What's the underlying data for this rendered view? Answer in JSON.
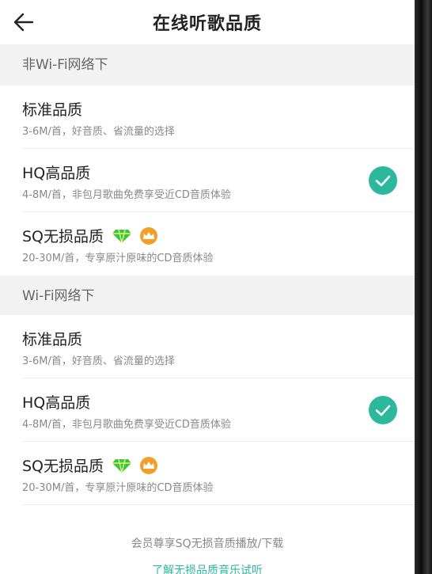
{
  "header": {
    "title": "在线听歌品质"
  },
  "colors": {
    "accent": "#2bb89c",
    "vip_orange": "#f0a02a",
    "gem_green": "#3fc24a"
  },
  "sections": [
    {
      "title": "非Wi-Fi网络下",
      "options": [
        {
          "title": "标准品质",
          "desc": "3-6M/首，好音质、省流量的选择",
          "selected": false
        },
        {
          "title": "HQ高品质",
          "desc": "4-8M/首，非包月歌曲免费享受近CD音质体验",
          "selected": true
        },
        {
          "title": "SQ无损品质",
          "desc": "20-30M/首，专享原汁原味的CD音质体验",
          "selected": false,
          "badges": [
            "gem-icon",
            "vip-crown-icon"
          ]
        }
      ]
    },
    {
      "title": "Wi-Fi网络下",
      "options": [
        {
          "title": "标准品质",
          "desc": "3-6M/首，好音质、省流量的选择",
          "selected": false
        },
        {
          "title": "HQ高品质",
          "desc": "4-8M/首，非包月歌曲免费享受近CD音质体验",
          "selected": true
        },
        {
          "title": "SQ无损品质",
          "desc": "20-30M/首，专享原汁原味的CD音质体验",
          "selected": false,
          "badges": [
            "gem-icon",
            "vip-crown-icon"
          ]
        }
      ]
    }
  ],
  "footer": {
    "note": "会员尊享SQ无损音质播放/下载",
    "link": "了解无损品质音乐试听"
  }
}
